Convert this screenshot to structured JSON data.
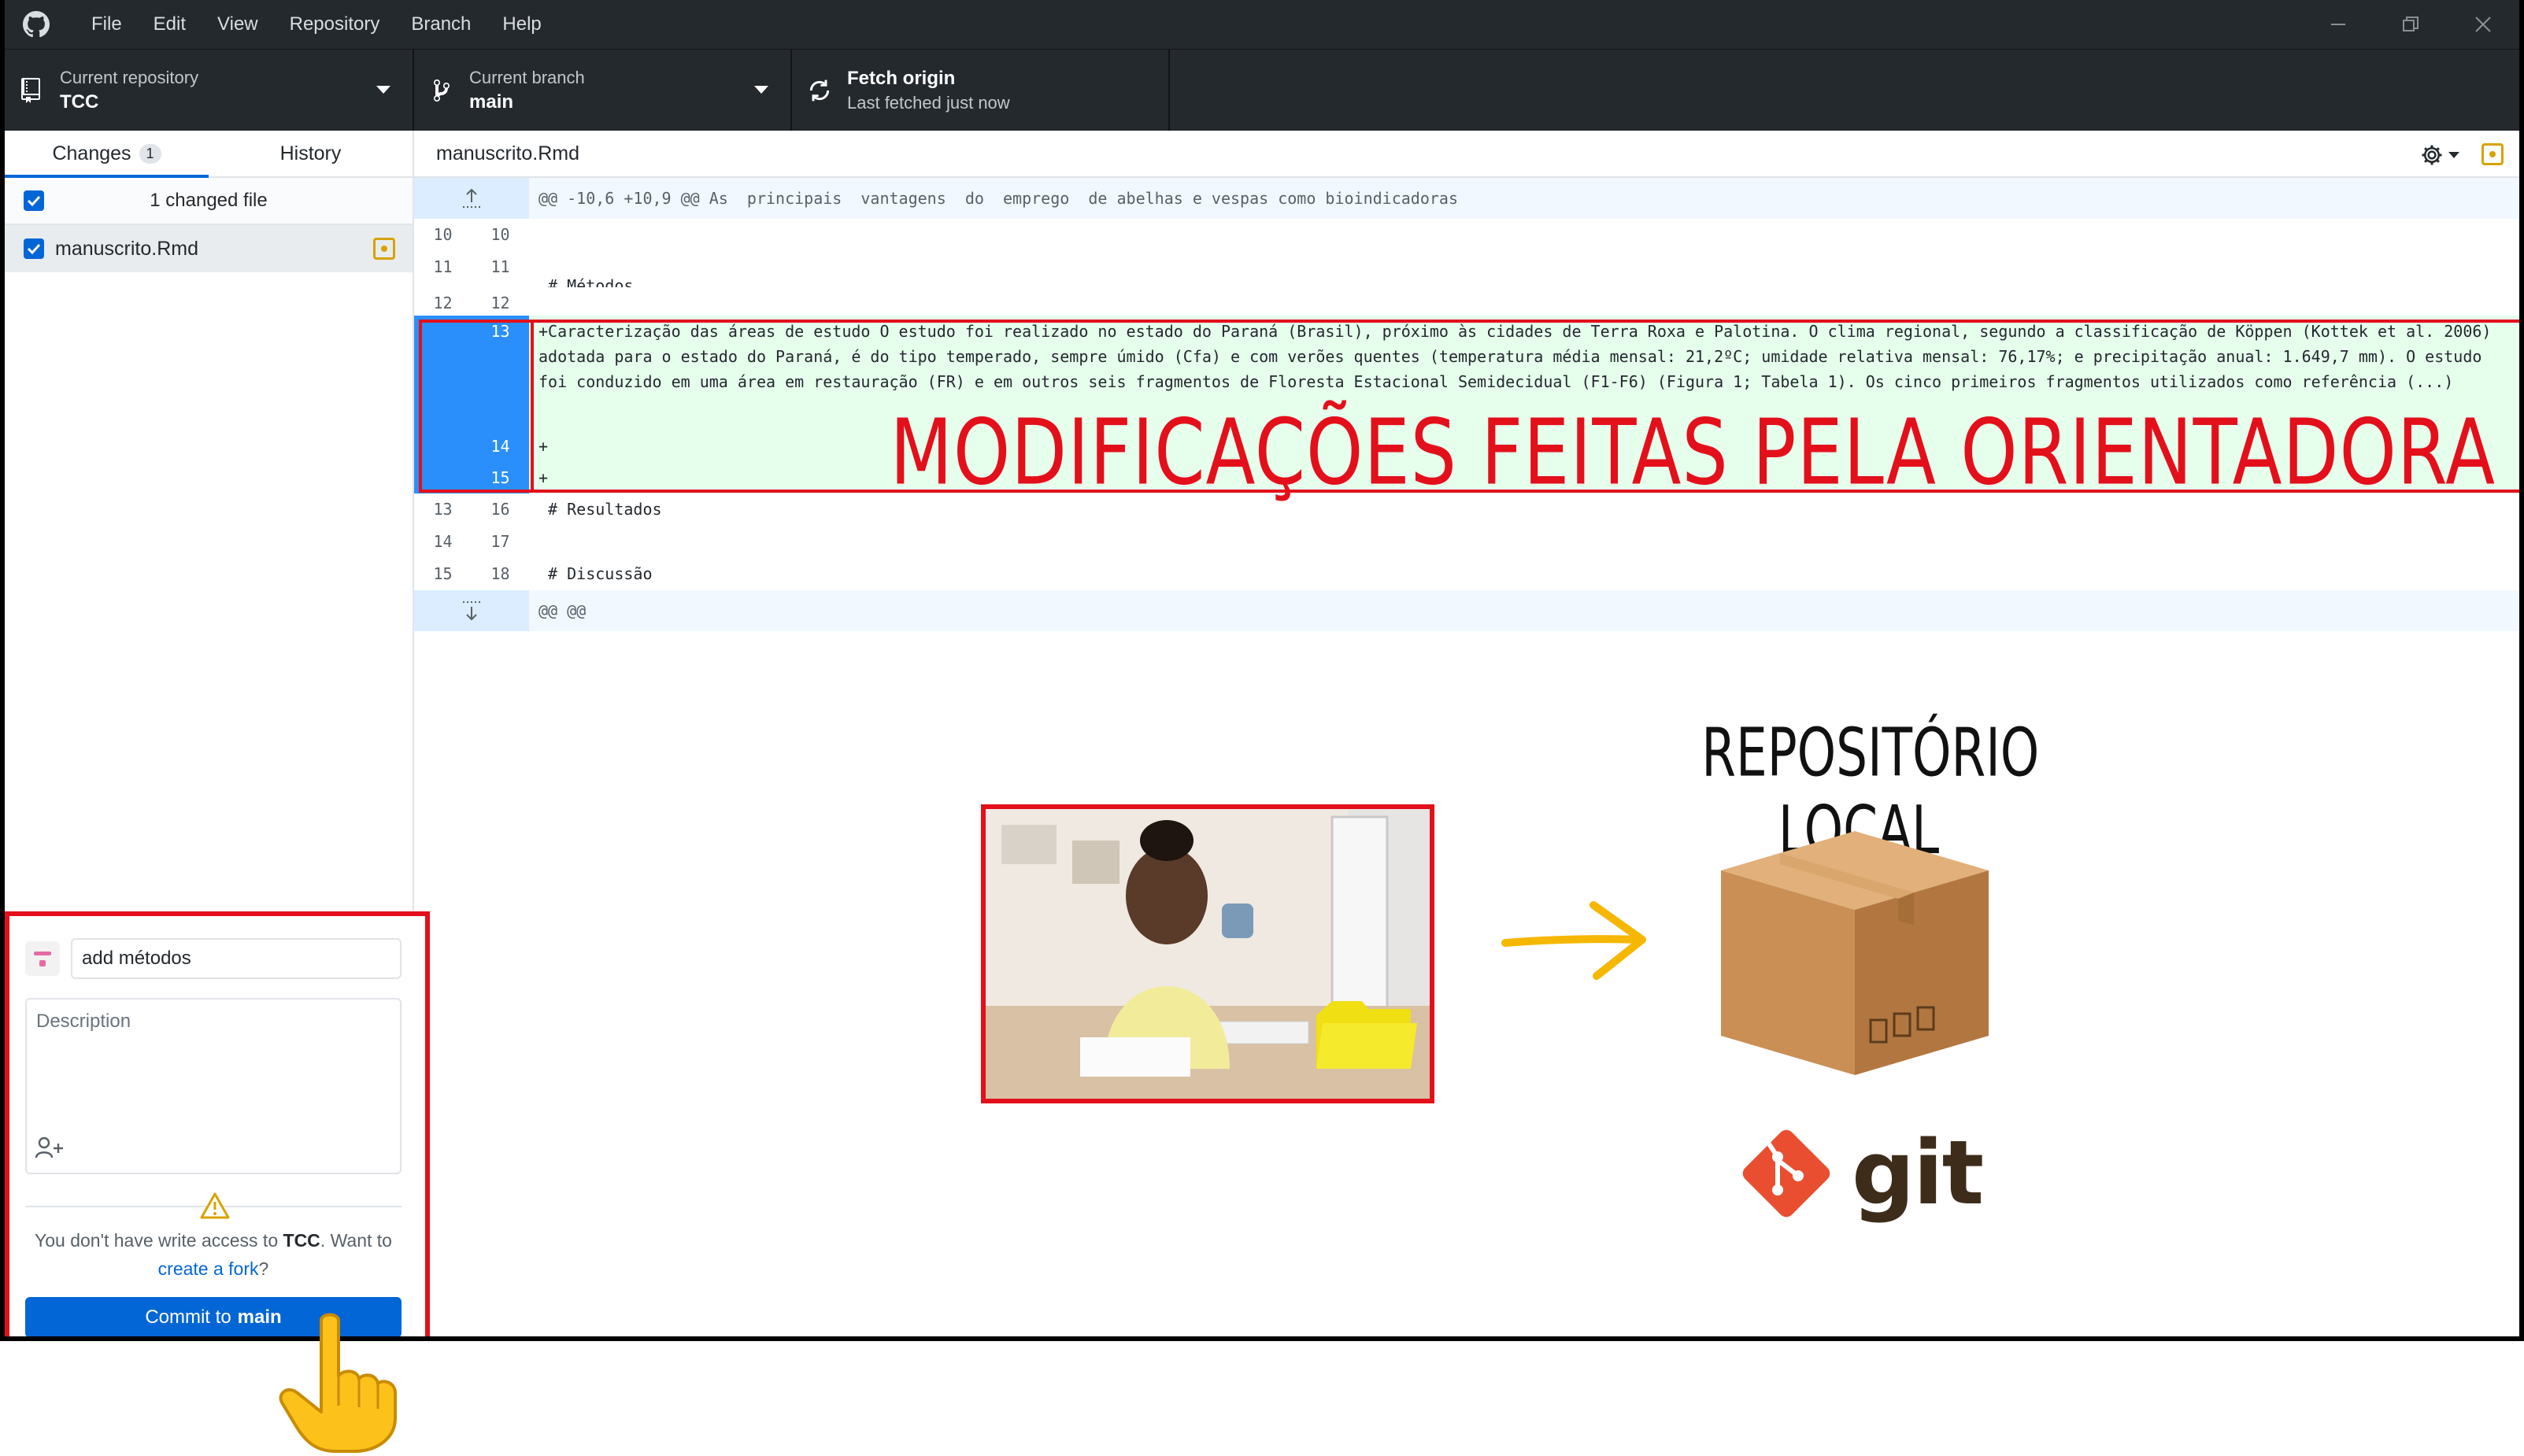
{
  "menu": [
    "File",
    "Edit",
    "View",
    "Repository",
    "Branch",
    "Help"
  ],
  "toolbar": {
    "repo_label": "Current repository",
    "repo_value": "TCC",
    "branch_label": "Current branch",
    "branch_value": "main",
    "fetch_label": "Fetch origin",
    "fetch_value": "Last fetched just now"
  },
  "sidebar": {
    "tab_changes": "Changes",
    "tab_changes_count": "1",
    "tab_history": "History",
    "changed_files": "1 changed file",
    "file_name": "manuscrito.Rmd"
  },
  "commit": {
    "summary": "add métodos",
    "description_placeholder": "Description",
    "warning_prefix": "You don't have write access to ",
    "warning_repo": "TCC",
    "warning_mid": ". Want to ",
    "warning_link": "create a fork",
    "warning_suffix": "?",
    "button_prefix": "Commit to",
    "button_branch": "main"
  },
  "diff": {
    "file_header": "manuscrito.Rmd",
    "hunk_header": "@@ -10,6 +10,9 @@ As  principais  vantagens  do  emprego  de abelhas e vespas como bioindicadoras",
    "lines": [
      {
        "old": "10",
        "new": "10",
        "text": ""
      },
      {
        "old": "11",
        "new": "11",
        "text": " # Métodos"
      },
      {
        "old": "12",
        "new": "12",
        "text": ""
      }
    ],
    "added": {
      "new1": "13",
      "text": "+Caracterização das áreas de estudo O estudo foi realizado no estado do Paraná (Brasil), próximo às cidades de Terra Roxa e Palotina. O clima regional, segundo a classificação de Köppen (Kottek et al. 2006) adotada para o estado do Paraná, é do tipo temperado, sempre úmido (Cfa) e com verões quentes (temperatura média mensal: 21,2ºC; umidade relativa mensal: 76,17%; e precipitação anual: 1.649,7 mm). O estudo foi conduzido em uma área em restauração (FR) e em outros seis fragmentos de Floresta Estacional Semidecidual (F1-F6) (Figura 1; Tabela 1). Os cinco primeiros fragmentos utilizados como referência (...)",
      "new2": "14",
      "text2": "+",
      "new3": "15",
      "text3": "+"
    },
    "trailing": [
      {
        "old": "13",
        "new": "16",
        "text": " # Resultados"
      },
      {
        "old": "14",
        "new": "17",
        "text": ""
      },
      {
        "old": "15",
        "new": "18",
        "text": " # Discussão"
      }
    ],
    "end_hunk": "@@ @@"
  },
  "annotation": "MODIFICAÇÕES FEITAS PELA ORIENTADORA",
  "illustration": {
    "repo_title": "REPOSITÓRIO LOCAL",
    "git_text": "git"
  },
  "colors": {
    "accent": "#0366d6",
    "annotation_red": "#e3101b",
    "added_bg": "#e6ffed",
    "titlebar": "#24292e"
  }
}
